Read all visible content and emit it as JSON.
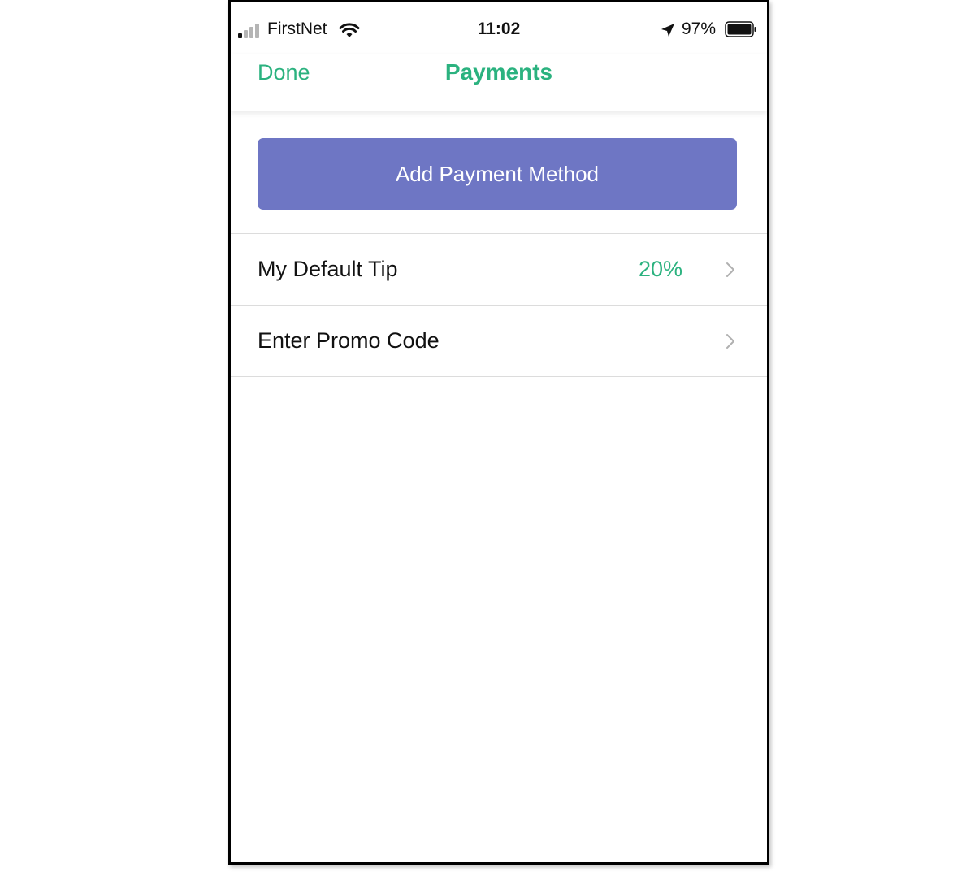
{
  "status_bar": {
    "carrier": "FirstNet",
    "time": "11:02",
    "battery_percent": "97%",
    "signal_bars_filled": 1,
    "signal_bars_total": 4,
    "battery_level": 0.97,
    "icons": [
      "signal-icon",
      "wifi-icon",
      "location-arrow-icon",
      "battery-icon"
    ]
  },
  "nav": {
    "done_label": "Done",
    "title": "Payments"
  },
  "main": {
    "add_payment_label": "Add Payment Method",
    "rows": [
      {
        "label": "My Default Tip",
        "value": "20%",
        "icon": "chevron-right-icon"
      },
      {
        "label": "Enter Promo Code",
        "value": "",
        "icon": "chevron-right-icon"
      }
    ]
  },
  "colors": {
    "accent_green": "#2bb27f",
    "button_purple": "#6e76c4",
    "separator": "#dcdcdc",
    "text": "#111111"
  }
}
